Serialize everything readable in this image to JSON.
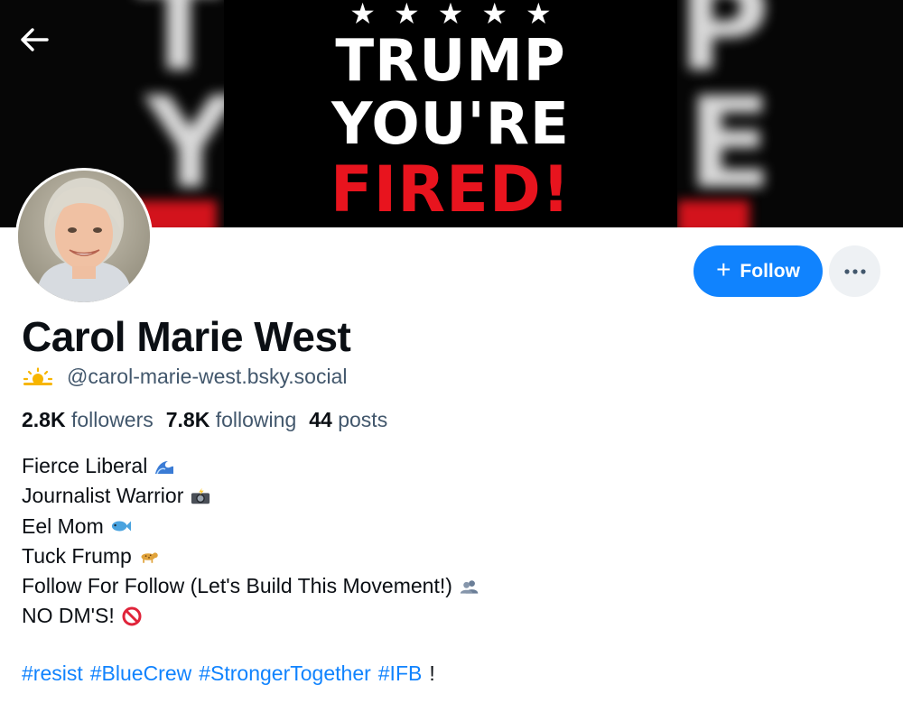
{
  "banner": {
    "stars": [
      "★",
      "★",
      "★",
      "★",
      "★"
    ],
    "line1": "TRUMP",
    "line2": "YOU'RE",
    "line3": "FIRED!",
    "ghost_left_1": "T",
    "ghost_left_2": "Y",
    "ghost_right_1": "P",
    "ghost_right_2": "E",
    "colors": {
      "background": "#000000",
      "text": "#ffffff",
      "red": "#e8141e"
    }
  },
  "nav": {
    "back_icon": "arrow-left-icon"
  },
  "profile": {
    "display_name": "Carol Marie West",
    "handle_icon": "sun-behind-cloud-icon",
    "handle": "@carol-marie-west.bsky.social",
    "followers_count": "2.8K",
    "followers_label": "followers",
    "following_count": "7.8K",
    "following_label": "following",
    "posts_count": "44",
    "posts_label": "posts"
  },
  "actions": {
    "follow_icon": "plus-icon",
    "follow_label": "Follow",
    "more_icon": "ellipsis-icon",
    "accent_color": "#1083fe"
  },
  "bio": {
    "lines": [
      {
        "text": "Fierce Liberal",
        "emoji": "wave-icon"
      },
      {
        "text": "Journalist Warrior",
        "emoji": "camera-flash-icon"
      },
      {
        "text": "Eel Mom",
        "emoji": "fish-icon"
      },
      {
        "text": "Tuck Frump",
        "emoji": "leopard-icon"
      },
      {
        "text": "Follow For Follow (Let's Build This Movement!)",
        "emoji": "busts-icon"
      },
      {
        "text": "NO DM'S!",
        "emoji": "prohibited-icon"
      }
    ],
    "hashtags": [
      "#resist",
      "#BlueCrew",
      "#StrongerTogether",
      "#IFB"
    ],
    "hashtag_suffix": "!"
  }
}
